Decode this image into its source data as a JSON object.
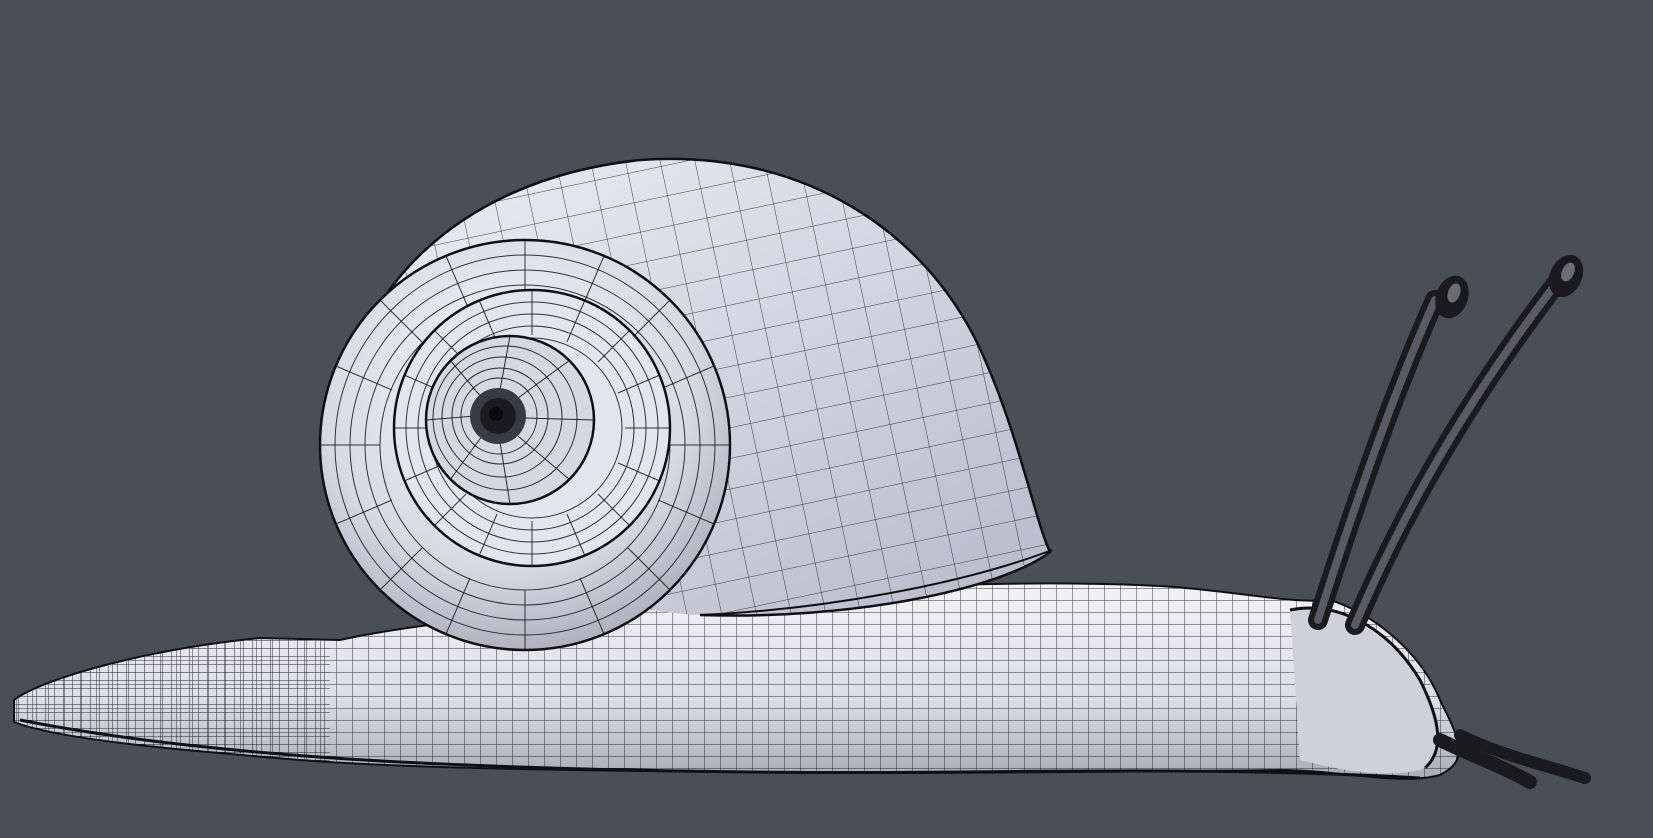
{
  "viewport": {
    "background_color": "#4a4f56",
    "render_mode": "wireframe-on-shaded"
  },
  "model": {
    "subject": "snail",
    "mesh_colors": {
      "shell_fill": "#dadbe6",
      "shell_highlight": "#f4f4fa",
      "shell_shadow": "#a4a6b4",
      "body_fill": "#e8e8ee",
      "body_shadow": "#b9bac4",
      "wire_color": "#101014",
      "dark_tentacle": "#222226"
    }
  }
}
